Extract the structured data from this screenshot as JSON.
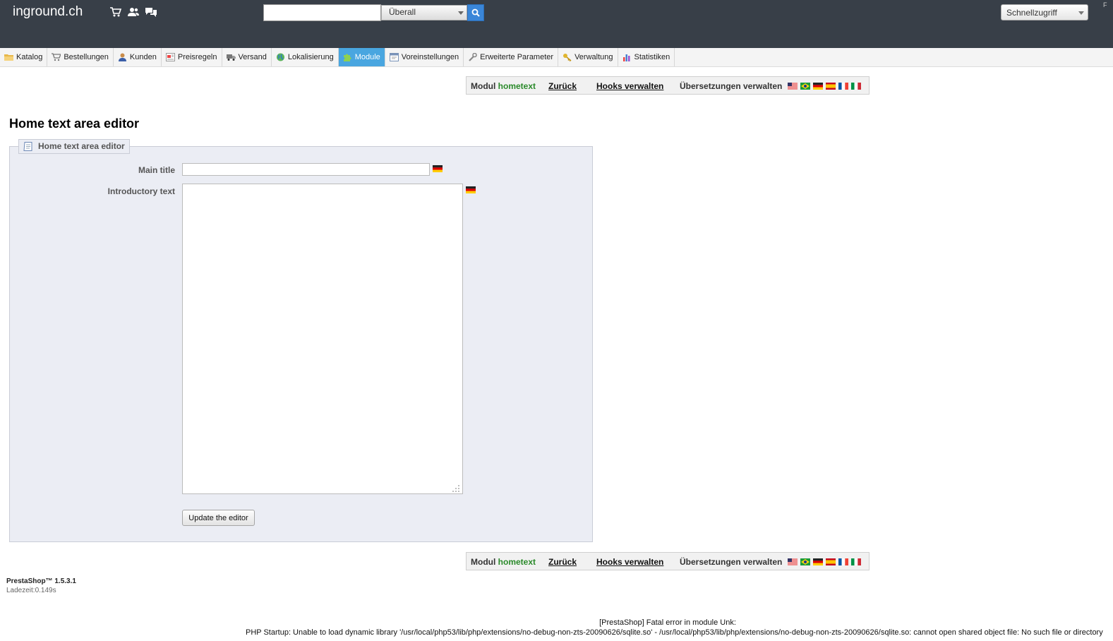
{
  "header": {
    "shop_name": "inground.ch",
    "search": {
      "value": "",
      "scope": "Überall"
    },
    "quick_access": "Schnellzugriff",
    "edge_text": "F"
  },
  "menu": {
    "tabs": [
      {
        "label": "Katalog",
        "icon": "folder-icon"
      },
      {
        "label": "Bestellungen",
        "icon": "cart-icon"
      },
      {
        "label": "Kunden",
        "icon": "user-icon"
      },
      {
        "label": "Preisregeln",
        "icon": "price-tag-icon"
      },
      {
        "label": "Versand",
        "icon": "truck-icon"
      },
      {
        "label": "Lokalisierung",
        "icon": "globe-icon"
      },
      {
        "label": "Module",
        "icon": "puzzle-icon",
        "active": true
      },
      {
        "label": "Voreinstellungen",
        "icon": "preferences-icon"
      },
      {
        "label": "Erweiterte Parameter",
        "icon": "wrench-icon"
      },
      {
        "label": "Verwaltung",
        "icon": "key-icon"
      },
      {
        "label": "Statistiken",
        "icon": "stats-icon"
      }
    ]
  },
  "toolbar": {
    "module_prefix": "Modul",
    "module_name": "hometext",
    "back": "Zurück",
    "hooks": "Hooks verwalten",
    "translations": "Übersetzungen verwalten",
    "flags": [
      "us",
      "br",
      "de",
      "es",
      "fr",
      "it"
    ]
  },
  "page": {
    "title": "Home text area editor",
    "legend": "Home text area editor",
    "main_title_label": "Main title",
    "main_title_value": "",
    "intro_label": "Introductory text",
    "intro_value": "",
    "update_button": "Update the editor"
  },
  "footer": {
    "version": "PrestaShop™ 1.5.3.1",
    "load_time": "Ladezeit:0.149s",
    "error_title": "[PrestaShop] Fatal error in module Unk:",
    "error_detail": "PHP Startup: Unable to load dynamic library '/usr/local/php53/lib/php/extensions/no-debug-non-zts-20090626/sqlite.so' - /usr/local/php53/lib/php/extensions/no-debug-non-zts-20090626/sqlite.so: cannot open shared object file: No such file or directory"
  },
  "colors": {
    "header_bg": "#383f48",
    "active_tab": "#49a6e0",
    "module_name": "#2a8a2a",
    "search_button": "#3a86d8"
  }
}
